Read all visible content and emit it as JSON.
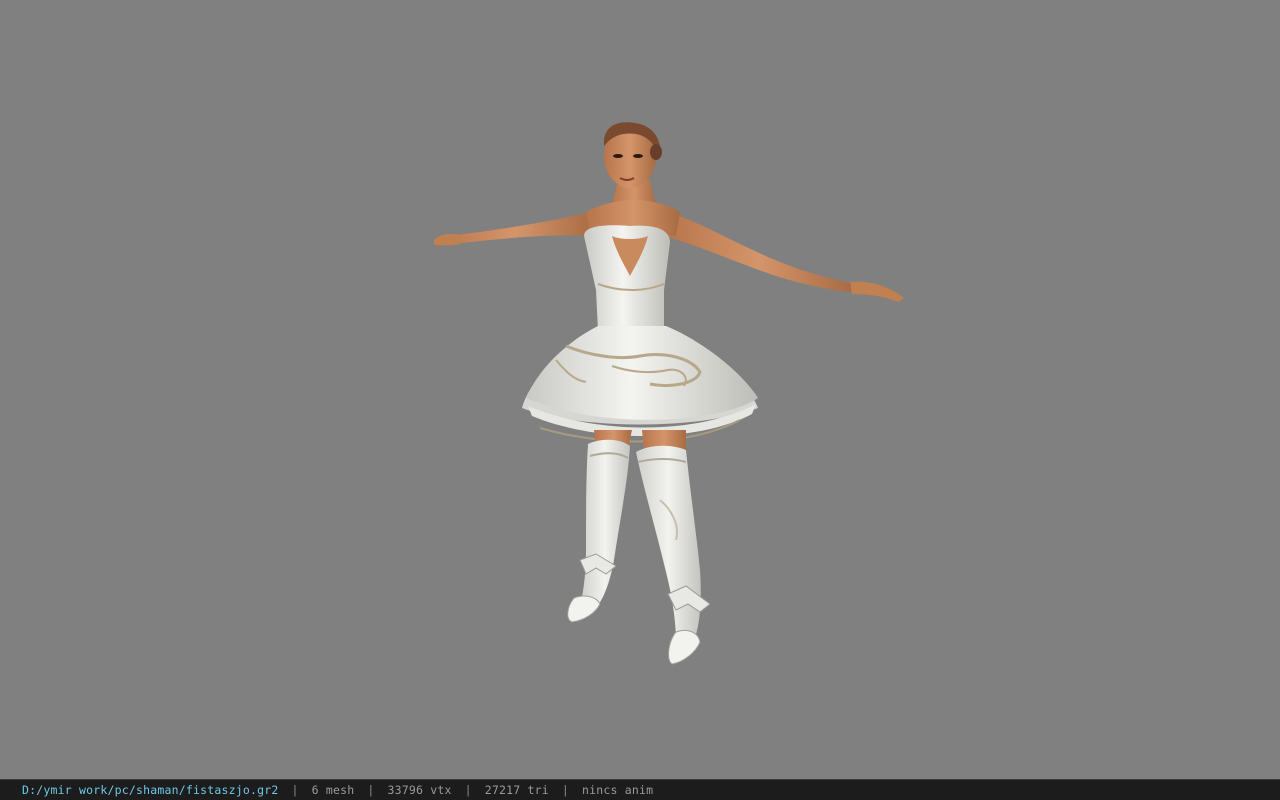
{
  "viewer": {
    "background_color": "#808080"
  },
  "model": {
    "icon": "character-model-tpose",
    "description_colors": {
      "skin": "#c98a5e",
      "dress": "#eeeeea",
      "trim": "#b8a88a"
    }
  },
  "status_bar": {
    "file_path": "D:/ymir work/pc/shaman/fistaszjo.gr2",
    "separator": "|",
    "mesh_count": "6 mesh",
    "vertex_count": "33796 vtx",
    "triangle_count": "27217 tri",
    "animation_status": "nincs anim",
    "path_color": "#6ec8e6",
    "background_color": "#1c1c1c"
  }
}
